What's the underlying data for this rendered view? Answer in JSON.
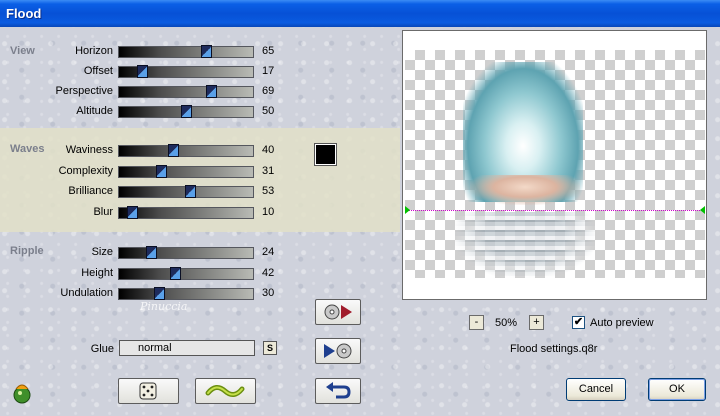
{
  "window": {
    "title": "Flood"
  },
  "sections": {
    "view": {
      "label": "View",
      "params": [
        {
          "label": "Horizon",
          "value": "65",
          "level": 65
        },
        {
          "label": "Offset",
          "value": "17",
          "level": 17
        },
        {
          "label": "Perspective",
          "value": "69",
          "level": 69
        },
        {
          "label": "Altitude",
          "value": "50",
          "level": 50
        }
      ]
    },
    "waves": {
      "label": "Waves",
      "params": [
        {
          "label": "Waviness",
          "value": "40",
          "level": 40
        },
        {
          "label": "Complexity",
          "value": "31",
          "level": 31
        },
        {
          "label": "Brilliance",
          "value": "53",
          "level": 53
        },
        {
          "label": "Blur",
          "value": "10",
          "level": 10
        }
      ]
    },
    "ripple": {
      "label": "Ripple",
      "params": [
        {
          "label": "Size",
          "value": "24",
          "level": 24
        },
        {
          "label": "Height",
          "value": "42",
          "level": 42
        },
        {
          "label": "Undulation",
          "value": "30",
          "level": 30
        }
      ]
    }
  },
  "color": {
    "swatch": "#000000"
  },
  "glue": {
    "label": "Glue",
    "value": "normal",
    "button": "S"
  },
  "preview": {
    "zoom": "50%",
    "zoom_minus": "-",
    "zoom_plus": "+",
    "auto_preview_label": "Auto preview",
    "auto_preview_checked": true,
    "settings_file": "Flood settings.q8r"
  },
  "buttons": {
    "cancel": "Cancel",
    "ok": "OK"
  },
  "watermark": "Pinuccia",
  "icons": {
    "load_settings": "cd-play-icon",
    "save_settings": "play-cd-icon",
    "random": "dice-icon",
    "reset": "wave-icon",
    "undo": "undo-arrow-icon",
    "logo": "filter-logo-icon"
  }
}
